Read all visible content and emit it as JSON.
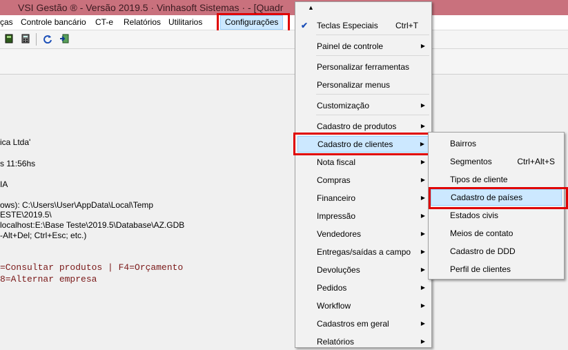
{
  "window": {
    "title": "VSI Gestão ® - Versão 2019.5 · Vinhasoft Sistemas ·  - [Quadr"
  },
  "menubar": {
    "items": [
      {
        "label": "ças",
        "u": ""
      },
      {
        "label": "Controle bancário",
        "u": ""
      },
      {
        "label": "CT-e",
        "u": ""
      },
      {
        "label": "Relatórios",
        "u": ""
      },
      {
        "label": "Utilitarios",
        "u": ""
      },
      {
        "label": "Configurações",
        "u": ""
      }
    ]
  },
  "info_lines": [
    "ica Ltda'",
    "s 11:56hs",
    "IA",
    "ows): C:\\Users\\User\\AppData\\Local\\Temp",
    "ESTE\\2019.5\\",
    "localhost:E:\\Base Teste\\2019.5\\Database\\AZ.GDB",
    "-Alt+Del; Ctrl+Esc; etc.)"
  ],
  "shortcut_lines": [
    "=Consultar produtos | F4=Orçamento",
    "8=Alternar empresa"
  ],
  "config_menu": {
    "scroll_up": "▲",
    "items": [
      {
        "label": "Teclas Especiais",
        "shortcut": "Ctrl+T",
        "checked": true
      },
      {
        "label": "Painel de controle",
        "submenu": true
      },
      {
        "label": "Personalizar ferramentas"
      },
      {
        "label": "Personalizar menus"
      },
      {
        "label": "Customização",
        "submenu": true
      },
      {
        "label": "Cadastro de produtos",
        "submenu": true
      },
      {
        "label": "Cadastro de clientes",
        "submenu": true,
        "highlighted": true
      },
      {
        "label": "Nota fiscal",
        "submenu": true
      },
      {
        "label": "Compras",
        "submenu": true
      },
      {
        "label": "Financeiro",
        "submenu": true
      },
      {
        "label": "Impressão",
        "submenu": true
      },
      {
        "label": "Vendedores",
        "submenu": true
      },
      {
        "label": "Entregas/saídas a campo",
        "submenu": true
      },
      {
        "label": "Devoluções",
        "submenu": true
      },
      {
        "label": "Pedidos",
        "submenu": true
      },
      {
        "label": "Workflow",
        "submenu": true
      },
      {
        "label": "Cadastros em geral",
        "submenu": true
      },
      {
        "label": "Relatórios",
        "submenu": true
      }
    ]
  },
  "clientes_submenu": {
    "items": [
      {
        "label": "Bairros"
      },
      {
        "label": "Segmentos",
        "shortcut": "Ctrl+Alt+S"
      },
      {
        "label": "Tipos de cliente"
      },
      {
        "label": "Cadastro de países",
        "highlighted": true
      },
      {
        "label": "Estados civis"
      },
      {
        "label": "Meios de contato"
      },
      {
        "label": "Cadastro de DDD"
      },
      {
        "label": "Perfil de clientes"
      }
    ]
  },
  "colors": {
    "titlebar": "#c9717d",
    "highlight": "#cce8ff",
    "annotation": "#e00000"
  },
  "icons": [
    "book-icon",
    "calculator-icon",
    "refresh-icon",
    "exit-icon",
    "check-icon",
    "chevron-right-icon",
    "scroll-up-icon"
  ]
}
